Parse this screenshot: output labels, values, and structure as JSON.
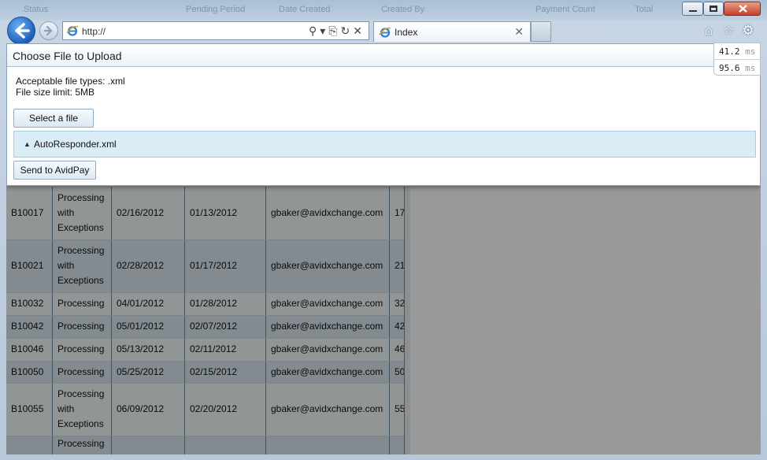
{
  "browser": {
    "address_prefix": "http://",
    "tab_label": "Index",
    "bg_columns": [
      "Status",
      "Pending Period",
      "Date Created",
      "Created By",
      "Payment Count",
      "Total"
    ]
  },
  "perf": {
    "value1": "41.2",
    "value2": "95.6",
    "unit": "ms"
  },
  "dialog": {
    "title": "Choose File to Upload",
    "acceptable_types": "Acceptable file types: .xml",
    "size_limit": "File size limit: 5MB",
    "select_label": "Select a file",
    "file_name": "AutoResponder.xml",
    "send_label": "Send to AvidPay"
  },
  "table": {
    "rows": [
      {
        "id": "B10017",
        "status": "Processing with Exceptions",
        "date1": "02/16/2012",
        "date2": "01/13/2012",
        "email": "gbaker@avidxchange.com",
        "count": "17"
      },
      {
        "id": "B10021",
        "status": "Processing with Exceptions",
        "date1": "02/28/2012",
        "date2": "01/17/2012",
        "email": "gbaker@avidxchange.com",
        "count": "21"
      },
      {
        "id": "B10032",
        "status": "Processing",
        "date1": "04/01/2012",
        "date2": "01/28/2012",
        "email": "gbaker@avidxchange.com",
        "count": "32"
      },
      {
        "id": "B10042",
        "status": "Processing",
        "date1": "05/01/2012",
        "date2": "02/07/2012",
        "email": "gbaker@avidxchange.com",
        "count": "42"
      },
      {
        "id": "B10046",
        "status": "Processing",
        "date1": "05/13/2012",
        "date2": "02/11/2012",
        "email": "gbaker@avidxchange.com",
        "count": "46"
      },
      {
        "id": "B10050",
        "status": "Processing",
        "date1": "05/25/2012",
        "date2": "02/15/2012",
        "email": "gbaker@avidxchange.com",
        "count": "50"
      },
      {
        "id": "B10055",
        "status": "Processing with Exceptions",
        "date1": "06/09/2012",
        "date2": "02/20/2012",
        "email": "gbaker@avidxchange.com",
        "count": "55"
      },
      {
        "id": "",
        "status": "Processing",
        "date1": "",
        "date2": "",
        "email": "",
        "count": ""
      }
    ]
  },
  "colors": {
    "accent": "#1d5fb8",
    "dialog_header": "#e9f2f9",
    "file_row": "#daedf6"
  }
}
